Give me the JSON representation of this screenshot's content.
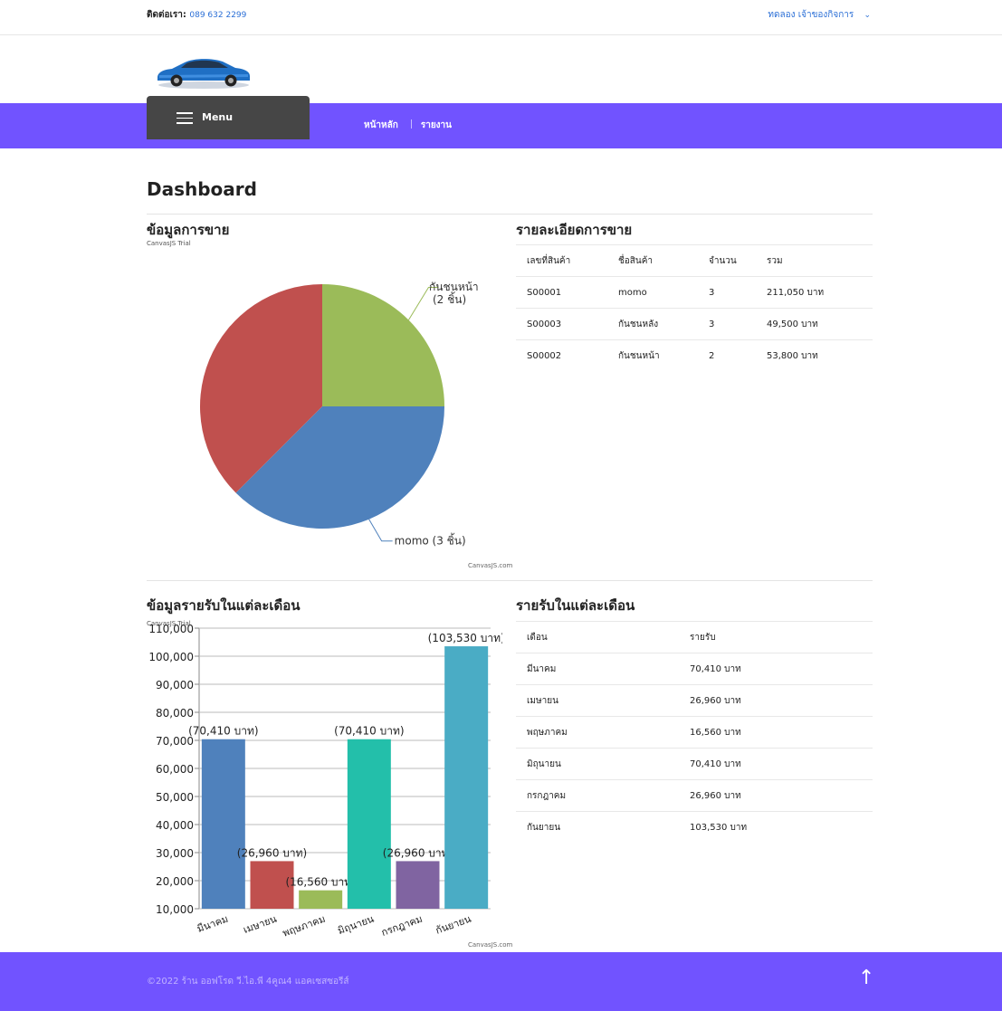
{
  "topbar": {
    "contact_label": "ติดต่อเรา:",
    "phone": "089 632 2299",
    "owner_link": "ทดลอง เจ้าของกิจการ"
  },
  "nav": {
    "menu_label": "Menu",
    "links": [
      "หน้าหลัก",
      "รายงาน"
    ]
  },
  "page_title": "Dashboard",
  "sales_chart": {
    "title": "ข้อมูลการขาย",
    "trial_text": "CanvasJS Trial",
    "credit": "CanvasJS.com"
  },
  "sales_detail": {
    "title": "รายละเอียดการขาย",
    "headers": [
      "เลขที่สินค้า",
      "ชื่อสินค้า",
      "จำนวน",
      "รวม"
    ],
    "rows": [
      [
        "S00001",
        "momo",
        "3",
        "211,050 บาท"
      ],
      [
        "S00003",
        "กันชนหลัง",
        "3",
        "49,500 บาท"
      ],
      [
        "S00002",
        "กันชนหน้า",
        "2",
        "53,800 บาท"
      ]
    ]
  },
  "income_chart": {
    "title": "ข้อมูลรายรับในแต่ละเดือน",
    "trial_text": "CanvasJS Trial",
    "credit": "CanvasJS.com"
  },
  "income_table": {
    "title": "รายรับในแต่ละเดือน",
    "headers": [
      "เดือน",
      "รายรับ"
    ],
    "rows": [
      [
        "มีนาคม",
        "70,410 บาท"
      ],
      [
        "เมษายน",
        "26,960 บาท"
      ],
      [
        "พฤษภาคม",
        "16,560 บาท"
      ],
      [
        "มิถุนายน",
        "70,410 บาท"
      ],
      [
        "กรกฎาคม",
        "26,960 บาท"
      ],
      [
        "กันยายน",
        "103,530 บาท"
      ]
    ]
  },
  "footer": {
    "copyright": "©2022 ร้าน ออฟโรด วี.ไอ.พี 4คูณ4 แอคเซสซอรีส์",
    "top_arrow": "↑"
  },
  "colors": {
    "accent": "#7153ff",
    "menu_bg": "#464646",
    "pie": [
      "#9bbb59",
      "#4f81bc",
      "#c0504e"
    ],
    "bars": [
      "#4f81bc",
      "#c0504e",
      "#9bbb59",
      "#23bfaa",
      "#8064a1",
      "#4aacc5"
    ]
  },
  "chart_data": [
    {
      "type": "pie",
      "labels": [
        "กันชนหน้า (2 ชิ้น)",
        "momo (3 ชิ้น)",
        ""
      ],
      "values": [
        2,
        3,
        3
      ]
    },
    {
      "type": "bar",
      "categories": [
        "มีนาคม",
        "เมษายน",
        "พฤษภาคม",
        "มิถุนายน",
        "กรกฎาคม",
        "กันยายน"
      ],
      "values": [
        70410,
        26960,
        16560,
        70410,
        26960,
        103530
      ],
      "data_labels": [
        "(70,410 บาท)",
        "(26,960 บาท)",
        "(16,560 บาท)",
        "(70,410 บาท)",
        "(26,960 บาท)",
        "(103,530 บาท)"
      ],
      "ylim": [
        10000,
        110000
      ],
      "yticks": [
        "10,000",
        "20,000",
        "30,000",
        "40,000",
        "50,000",
        "60,000",
        "70,000",
        "80,000",
        "90,000",
        "100,000",
        "110,000"
      ],
      "grid": true
    }
  ]
}
